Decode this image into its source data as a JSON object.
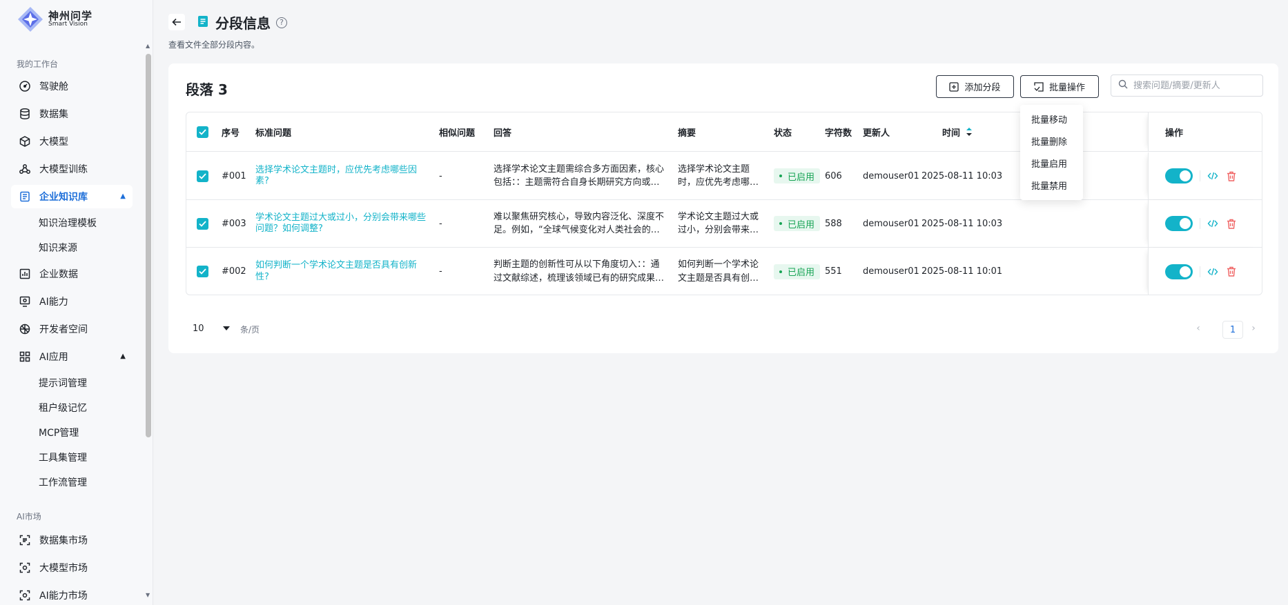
{
  "brand": {
    "name_cn": "神州问学",
    "name_en": "Smart Vision"
  },
  "sidebar": {
    "group1_label": "我的工作台",
    "items": [
      {
        "label": "驾驶舱",
        "icon": "dashboard-icon"
      },
      {
        "label": "数据集",
        "icon": "database-icon"
      },
      {
        "label": "大模型",
        "icon": "cube-icon"
      },
      {
        "label": "大模型训练",
        "icon": "training-icon"
      },
      {
        "label": "企业知识库",
        "icon": "knowledge-base-icon",
        "active": true,
        "expanded": true
      },
      {
        "label": "企业数据",
        "icon": "chart-icon"
      },
      {
        "label": "AI能力",
        "icon": "ai-ability-icon"
      },
      {
        "label": "开发者空间",
        "icon": "developer-icon"
      },
      {
        "label": "AI应用",
        "icon": "apps-icon",
        "expanded": true
      }
    ],
    "kb_sub": [
      "知识治理模板",
      "知识来源"
    ],
    "app_sub": [
      "提示词管理",
      "租户级记忆",
      "MCP管理",
      "工具集管理",
      "工作流管理"
    ],
    "group2_label": "AI市场",
    "market_items": [
      "数据集市场",
      "大模型市场",
      "AI能力市场"
    ]
  },
  "header": {
    "title": "分段信息",
    "subtitle": "查看文件全部分段内容。"
  },
  "card": {
    "title": "段落 3",
    "add_button": "添加分段",
    "batch_button": "批量操作",
    "search_placeholder": "搜索问题/摘要/更新人"
  },
  "table": {
    "columns": {
      "no": "序号",
      "question": "标准问题",
      "similar": "相似问题",
      "answer": "回答",
      "summary": "摘要",
      "status": "状态",
      "chars": "字符数",
      "updater": "更新人",
      "time": "时间",
      "ops": "操作"
    },
    "rows": [
      {
        "no": "#001",
        "question": "选择学术论文主题时，应优先考虑哪些因素?",
        "similar": "-",
        "answer": "选择学术论文主题需综合多方面因素，核心包括：：主题需符合自身长期研究方向或兴趣点，避免短期追热点",
        "summary": "选择学术论文主题时，应优先考虑哪些因素?",
        "status": "已启用",
        "chars": "606",
        "updater": "demouser01",
        "time": "2025-08-11 10:03",
        "enabled": true
      },
      {
        "no": "#003",
        "question": "学术论文主题过大或过小，分别会带来哪些问题？如何调整?",
        "similar": "-",
        "answer": "难以聚焦研究核心，导致内容泛化、深度不足。例如，“全球气候变化对人类社会的影响”这一主题范围过大",
        "summary": "学术论文主题过大或过小，分别会带来哪些问题",
        "status": "已启用",
        "chars": "588",
        "updater": "demouser01",
        "time": "2025-08-11 10:03",
        "enabled": true
      },
      {
        "no": "#002",
        "question": "如何判断一个学术论文主题是否具有创新性?",
        "similar": "-",
        "answer": "判断主题的创新性可从以下角度切入：：通过文献综述，梳理该领域已有的研究成果，明确当前研究空白",
        "summary": "如何判断一个学术论文主题是否具有创新性?",
        "status": "已启用",
        "chars": "551",
        "updater": "demouser01",
        "time": "2025-08-11 10:01",
        "enabled": true
      }
    ]
  },
  "dropdown": {
    "items": [
      "批量移动",
      "批量删除",
      "批量启用",
      "批量禁用"
    ]
  },
  "pagination": {
    "page_size": "10",
    "unit": "条/页",
    "current": "1"
  },
  "colors": {
    "accent": "#13b3c9",
    "link_blue": "#1e6fd9",
    "success": "#17a454",
    "danger": "#f06464"
  }
}
